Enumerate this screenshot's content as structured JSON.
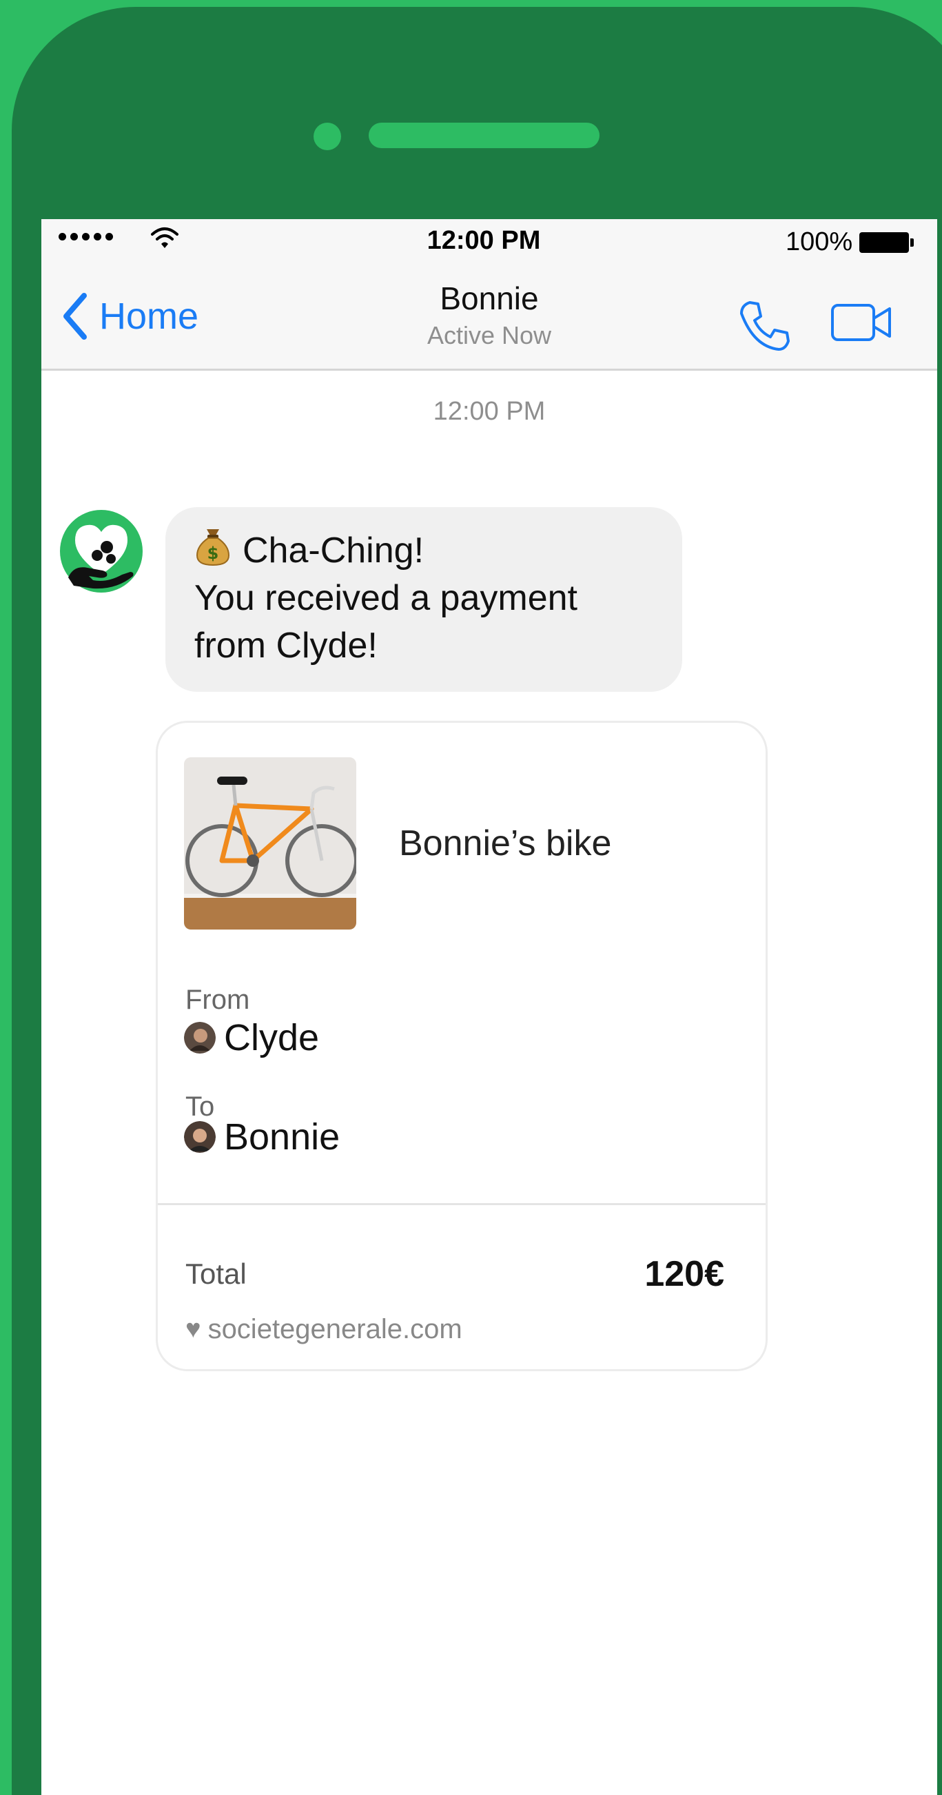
{
  "status_bar": {
    "time": "12:00 PM",
    "battery": "100%"
  },
  "nav": {
    "back_label": "Home",
    "contact_name": "Bonnie",
    "contact_status": "Active Now"
  },
  "conversation": {
    "timestamp": "12:00 PM",
    "message": {
      "line1": "Cha-Ching!",
      "line2": "You received a payment",
      "line3": "from Clyde!"
    }
  },
  "receipt": {
    "product_title": "Bonnie’s bike",
    "from_label": "From",
    "from_name": "Clyde",
    "to_label": "To",
    "to_name": "Bonnie",
    "total_label": "Total",
    "total_value": "120€",
    "heart": "♥",
    "site": "societegenerale.com"
  },
  "icons": {
    "back": "chevron-left-icon",
    "call": "phone-icon",
    "video": "video-camera-icon",
    "bot_avatar": "heart-hand-icon",
    "money": "money-bag-icon"
  },
  "colors": {
    "background": "#2dbc63",
    "device": "#1c7c43",
    "accent": "#1a7cf5",
    "bubble": "#f0f0f0"
  }
}
